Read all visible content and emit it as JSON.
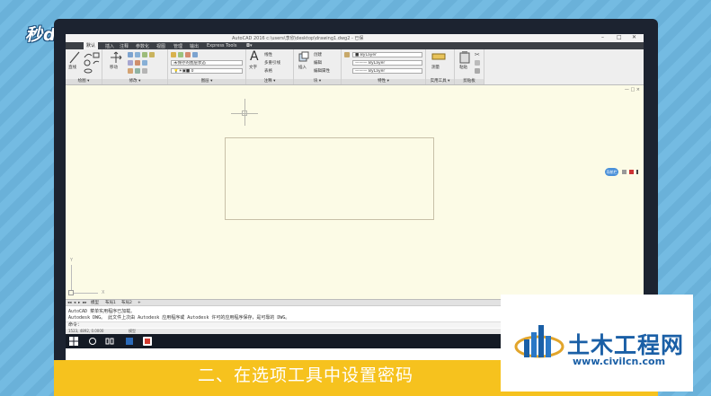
{
  "overlay": {
    "brand_logo": "秒dong视频",
    "caption": "二、在选项工具中设置密码",
    "watermark_title": "土木工程网",
    "watermark_url": "www.civilcn.com"
  },
  "window": {
    "title": "AutoCAD 2016    c:\\users\\李欣\\desktop\\drawing1.dwg2 - 已保",
    "min": "–",
    "max": "□",
    "close": "✕"
  },
  "ribbon_tabs": [
    "默认",
    "插入",
    "注释",
    "参数化",
    "视图",
    "管理",
    "输出",
    "Express Tools",
    "◘▾"
  ],
  "ribbon_active_tab": "默认",
  "panels": {
    "draw": {
      "label": "绘图 ▾",
      "tools": [
        "直线",
        "多段线",
        "圆",
        "圆弧"
      ]
    },
    "modify": {
      "label": "修改 ▾",
      "tools": [
        "移动",
        "复制",
        "拉伸"
      ]
    },
    "layers": {
      "label": "图层 ▾",
      "dropdown_state": "未保存的图层状态",
      "dropdown_layer": "0"
    },
    "annotation": {
      "label": "注释 ▾",
      "tools": [
        "文字",
        "线性",
        "多重引线",
        "表格"
      ]
    },
    "block": {
      "label": "块 ▾",
      "tools": [
        "插入",
        "创建",
        "编辑",
        "编辑属性"
      ]
    },
    "properties": {
      "label": "特性 ▾",
      "bylayer_color": "ByLayer",
      "bylayer_line": "——— ByLayer",
      "bylayer_weight": "——— ByLayer"
    },
    "utilities": {
      "label": "实用工具 ▾",
      "tools": [
        "测量"
      ]
    },
    "clipboard": {
      "label": "剪贴板",
      "tools": [
        "粘贴"
      ]
    }
  },
  "canvas": {
    "ucs_y": "Y",
    "ucs_x": "X",
    "view_controls": "— □ ×",
    "navbar_label": "导航栏"
  },
  "layout_tabs": [
    "◂◂",
    "◂",
    "▸",
    "▸▸",
    "模型",
    "布局1",
    "布局2",
    "+"
  ],
  "command_history": [
    "AutoCAD 菜单实用程序已加载。",
    "Autodesk DWG。  此文件上次由 Autodesk 应用程序或 Autodesk 许可的应用程序保存，是可靠的 DWG。"
  ],
  "command_prompt": "命令：",
  "status": {
    "coords": "1523, 4892, 0.0000",
    "model": "模型"
  },
  "colors": {
    "canvas_bg": "#fcfbe6",
    "ribbon_bg": "#eeeeee",
    "caption_bar": "#f6c21e",
    "watermark_blue": "#1a5fa6"
  }
}
